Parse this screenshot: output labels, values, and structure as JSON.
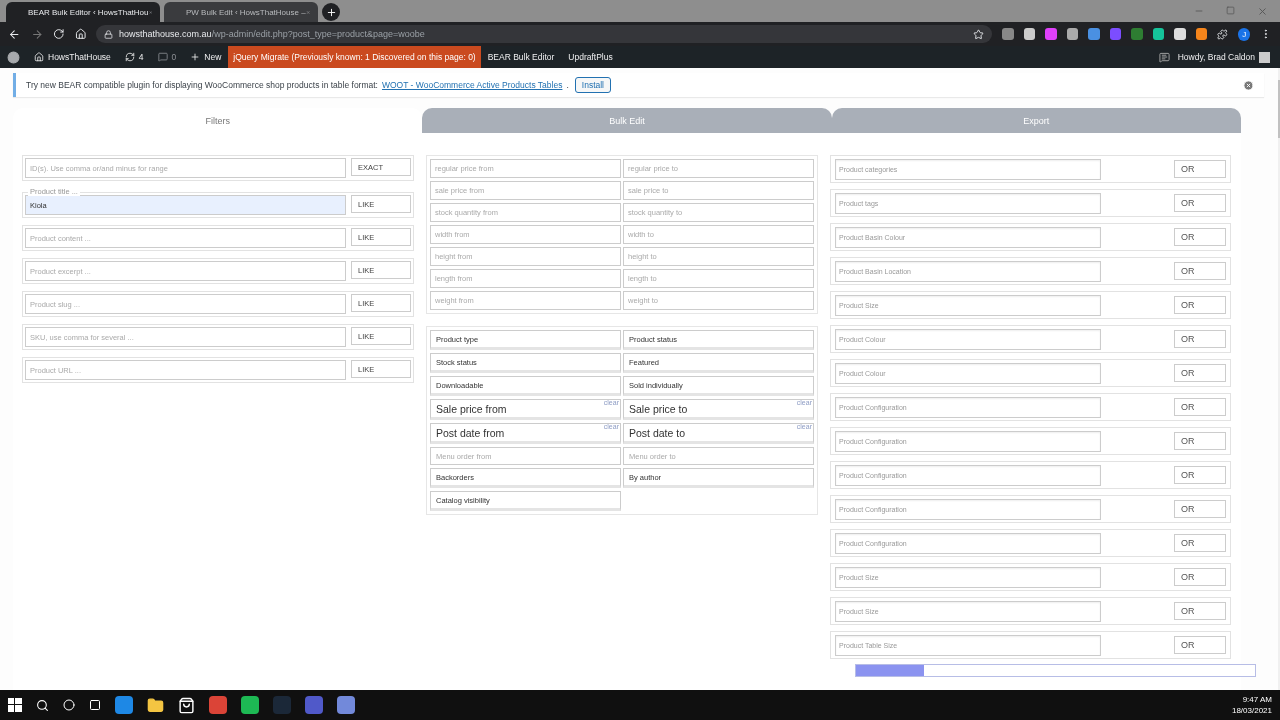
{
  "browser": {
    "tabs": [
      {
        "title": "BEAR Bulk Editor ‹ HowsThatHou",
        "selected": true
      },
      {
        "title": "PW Bulk Edit ‹ HowsThatHouse –",
        "selected": false
      }
    ],
    "domain": "howsthathouse.com.au",
    "path": "/wp-admin/edit.php?post_type=product&page=woobe",
    "profile": "J"
  },
  "admin_bar": {
    "site": "HowsThatHouse",
    "updates": "4",
    "comments": "0",
    "new": "New",
    "alert": "jQuery Migrate (Previously known: 1 Discovered on this page: 0)",
    "items": [
      "BEAR Bulk Editor",
      "UpdraftPlus"
    ],
    "greeting": "Howdy, Brad Caldon"
  },
  "notice": {
    "text": "Try new BEAR compatible plugin for displaying WooCommerce shop products in table format:",
    "link": "WOOT - WooCommerce Active Products Tables",
    "after": ".",
    "button": "Install"
  },
  "tabs": [
    {
      "label": "Filters",
      "selected": true
    },
    {
      "label": "Bulk Edit",
      "selected": false
    },
    {
      "label": "Export",
      "selected": false
    }
  ],
  "text_filters": [
    {
      "placeholder": "ID(s). Use comma or/and minus for range",
      "mode": "EXACT"
    },
    {
      "label": "Product title ...",
      "value": "Kiola",
      "mode": "LIKE"
    },
    {
      "placeholder": "Product content ...",
      "mode": "LIKE"
    },
    {
      "placeholder": "Product excerpt ...",
      "mode": "LIKE"
    },
    {
      "placeholder": "Product slug ...",
      "mode": "LIKE"
    },
    {
      "placeholder": "SKU, use comma for several ...",
      "mode": "LIKE"
    },
    {
      "placeholder": "Product URL ...",
      "mode": "LIKE"
    }
  ],
  "range_filters": [
    {
      "from": "regular price from",
      "to": "regular price to"
    },
    {
      "from": "sale price from",
      "to": "sale price to"
    },
    {
      "from": "stock quantity from",
      "to": "stock quantity to"
    },
    {
      "from": "width from",
      "to": "width to"
    },
    {
      "from": "height from",
      "to": "height to"
    },
    {
      "from": "length from",
      "to": "length to"
    },
    {
      "from": "weight from",
      "to": "weight to"
    }
  ],
  "options": [
    {
      "kind": "select",
      "label": "Product type"
    },
    {
      "kind": "select",
      "label": "Product status"
    },
    {
      "kind": "select",
      "label": "Stock status"
    },
    {
      "kind": "select",
      "label": "Featured"
    },
    {
      "kind": "select",
      "label": "Downloadable"
    },
    {
      "kind": "select",
      "label": "Sold individually"
    },
    {
      "kind": "date",
      "label": "Sale price from",
      "clear": "clear"
    },
    {
      "kind": "date",
      "label": "Sale price to",
      "clear": "clear"
    },
    {
      "kind": "date",
      "label": "Post date from",
      "clear": "clear"
    },
    {
      "kind": "date",
      "label": "Post date to",
      "clear": "clear"
    },
    {
      "kind": "input",
      "label": "Menu order from"
    },
    {
      "kind": "input",
      "label": "Menu order to"
    },
    {
      "kind": "select",
      "label": "Backorders"
    },
    {
      "kind": "select",
      "label": "By author"
    },
    {
      "kind": "select",
      "label": "Catalog visibility"
    }
  ],
  "taxonomy_filters": [
    {
      "placeholder": "Product categories",
      "logic": "OR"
    },
    {
      "placeholder": "Product tags",
      "logic": "OR"
    },
    {
      "placeholder": "Product Basin Colour",
      "logic": "OR"
    },
    {
      "placeholder": "Product Basin Location",
      "logic": "OR"
    },
    {
      "placeholder": "Product Size",
      "logic": "OR"
    },
    {
      "placeholder": "Product Colour",
      "logic": "OR"
    },
    {
      "placeholder": "Product Colour",
      "logic": "OR"
    },
    {
      "placeholder": "Product Configuration",
      "logic": "OR"
    },
    {
      "placeholder": "Product Configuration",
      "logic": "OR"
    },
    {
      "placeholder": "Product Configuration",
      "logic": "OR"
    },
    {
      "placeholder": "Product Configuration",
      "logic": "OR"
    },
    {
      "placeholder": "Product Configuration",
      "logic": "OR"
    },
    {
      "placeholder": "Product Size",
      "logic": "OR"
    },
    {
      "placeholder": "Product Size",
      "logic": "OR"
    },
    {
      "placeholder": "Product Table Size",
      "logic": "OR"
    }
  ],
  "loading": {
    "level": 0.17
  },
  "taskbar": {
    "time": "9:47 AM",
    "date": "18/03/2021"
  }
}
